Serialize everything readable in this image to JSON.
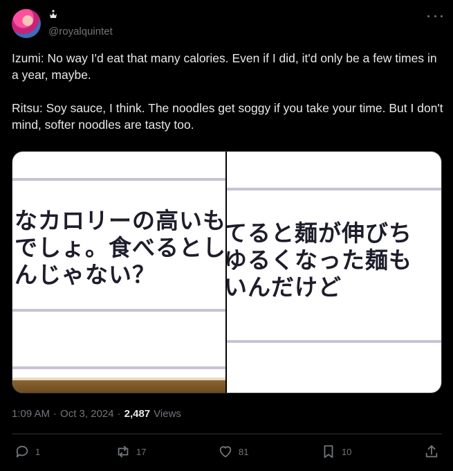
{
  "author": {
    "handle": "@royalquintet",
    "avatar_icon": "avatar",
    "name_icon": "crown-icon"
  },
  "post": {
    "text": "Izumi: No way I'd eat that many calories. Even if I did, it'd only be a few times in a year, maybe.\n\nRitsu: Soy sauce, I think. The noodles get soggy if you take your time. But I don't mind, softer noodles are tasty too.",
    "images": [
      {
        "text": "なカロリーの高いも\nでしょ。食べるとし\nんじゃない？"
      },
      {
        "text": "てると麺が伸びち\nゆるくなった麺も\nいんだけど"
      }
    ]
  },
  "meta": {
    "time": "1:09 AM",
    "separator": "·",
    "date": "Oct 3, 2024",
    "views_count": "2,487",
    "views_label": "Views"
  },
  "actions": {
    "replies": "1",
    "reposts": "17",
    "likes": "81",
    "bookmarks": "10"
  },
  "colors": {
    "background": "#000000",
    "text": "#e7e9ea",
    "muted": "#71767b",
    "border": "#2f3336"
  }
}
